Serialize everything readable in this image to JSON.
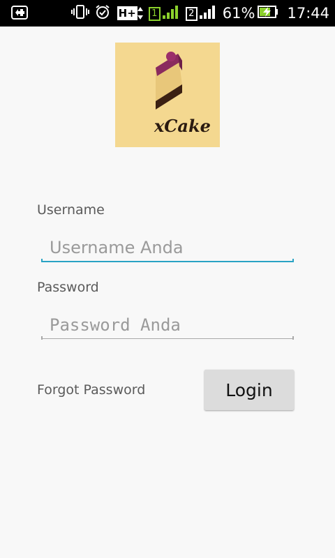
{
  "status_bar": {
    "network_type": "H+",
    "sim1_label": "1",
    "sim2_label": "2",
    "battery_percent": "61%",
    "time": "17:44",
    "icons": [
      "notification-icon",
      "vibrate-icon",
      "alarm-icon",
      "hplus-icon",
      "sim1-icon",
      "signal-icon",
      "sim2-icon",
      "signal-icon",
      "battery-charging-icon"
    ]
  },
  "logo": {
    "brand_text": "xCake",
    "colors": {
      "background": "#f4d890",
      "frosting": "#8a2a5e",
      "sponge": "#e8c77a",
      "base": "#3b2012"
    }
  },
  "form": {
    "username_label": "Username",
    "username_placeholder": "Username Anda",
    "username_value": "",
    "password_label": "Password",
    "password_placeholder": "Password Anda",
    "password_value": "",
    "forgot_label": "Forgot Password",
    "login_label": "Login"
  },
  "colors": {
    "accent": "#29a3c4",
    "background": "#f8f8f8",
    "button": "#dcdcdc"
  }
}
